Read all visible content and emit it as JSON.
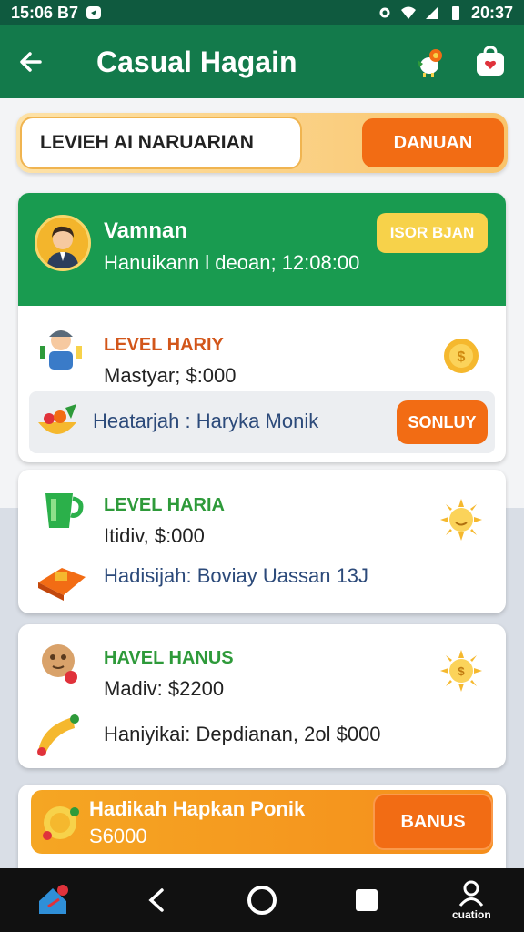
{
  "status_bar": {
    "left_text": "15:06 B7",
    "right_text": "20:37"
  },
  "app_bar": {
    "title": "Casual Hagain"
  },
  "search": {
    "value": "LEVIEH AI NARUARIAN",
    "button_label": "DANUAN"
  },
  "profile_card": {
    "name": "Vamnan",
    "subtitle": "Hanuikann l deoan; 12:08:00",
    "badge": "ISOR BJAN"
  },
  "levels": [
    {
      "title": "LEVEL HARIY",
      "price": "Mastyar; $:000",
      "detail": "Heatarjah : Haryka Monik",
      "detail_button": "SONLUY",
      "title_color": "#d2561a"
    },
    {
      "title": "LEVEL HARIA",
      "price": "Itidiv, $:000",
      "detail": "Hadisijah: Boviay Uassan 13J",
      "title_color": "#2e9a3a"
    },
    {
      "title": "HAVEL HANUS",
      "price": "Madiv: $2200",
      "detail": "Haniyikai: Depdianan, 2ol $000",
      "title_color": "#2e9a3a"
    }
  ],
  "promo": {
    "title": "Hadikah Hapkan Ponik",
    "amount": "S6000",
    "button_label": "BANUS"
  },
  "nav": {
    "profile_label": "cuation"
  },
  "colors": {
    "primary": "#137a4b",
    "accent": "#f26c14",
    "gold": "#f7d24a"
  }
}
